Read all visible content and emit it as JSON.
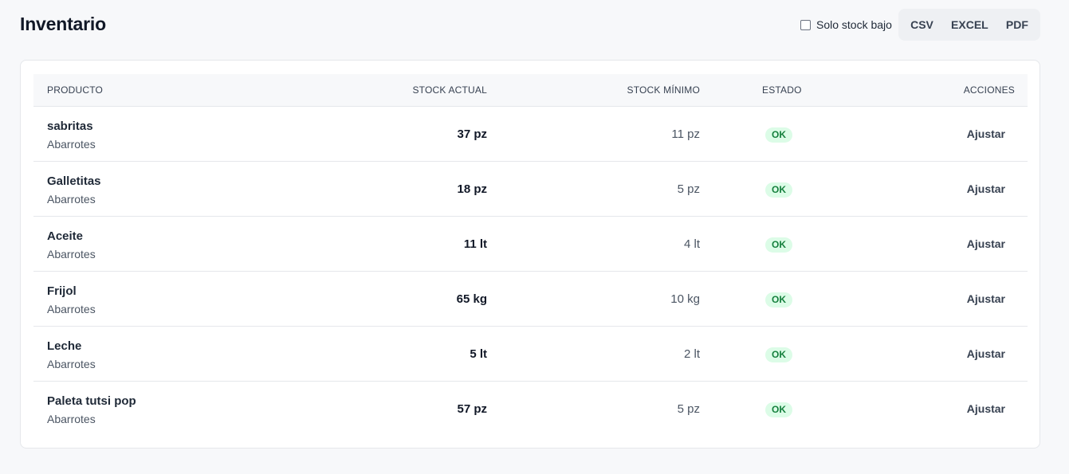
{
  "header": {
    "title": "Inventario",
    "filter_label": "Solo stock bajo",
    "export_buttons": [
      "CSV",
      "EXCEL",
      "PDF"
    ]
  },
  "table": {
    "columns": {
      "product": "PRODUCTO",
      "stock_actual": "STOCK ACTUAL",
      "stock_minimo": "STOCK MÍNIMO",
      "estado": "ESTADO",
      "acciones": "ACCIONES"
    },
    "rows": [
      {
        "name": "sabritas",
        "category": "Abarrotes",
        "stock": "37 pz",
        "min": "11 pz",
        "status": "OK",
        "action": "Ajustar"
      },
      {
        "name": "Galletitas",
        "category": "Abarrotes",
        "stock": "18 pz",
        "min": "5 pz",
        "status": "OK",
        "action": "Ajustar"
      },
      {
        "name": "Aceite",
        "category": "Abarrotes",
        "stock": "11 lt",
        "min": "4 lt",
        "status": "OK",
        "action": "Ajustar"
      },
      {
        "name": "Frijol",
        "category": "Abarrotes",
        "stock": "65 kg",
        "min": "10 kg",
        "status": "OK",
        "action": "Ajustar"
      },
      {
        "name": "Leche",
        "category": "Abarrotes",
        "stock": "5 lt",
        "min": "2 lt",
        "status": "OK",
        "action": "Ajustar"
      },
      {
        "name": "Paleta tutsi pop",
        "category": "Abarrotes",
        "stock": "57 pz",
        "min": "5 pz",
        "status": "OK",
        "action": "Ajustar"
      }
    ]
  },
  "colors": {
    "status_ok_bg": "#dcfce7",
    "status_ok_text": "#15803d"
  }
}
